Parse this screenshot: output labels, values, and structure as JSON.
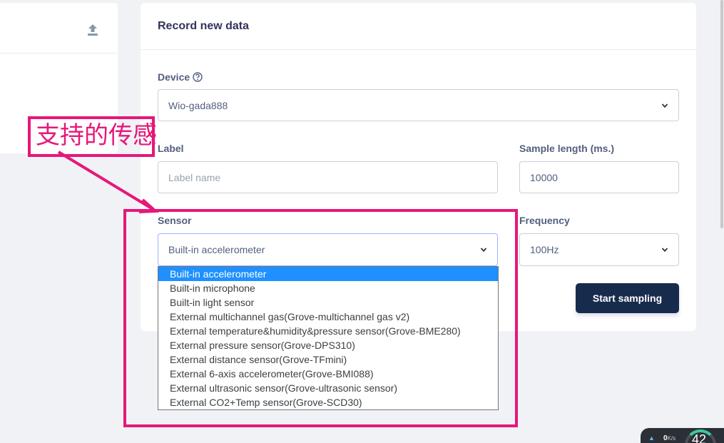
{
  "record_card": {
    "title": "Record new data",
    "device": {
      "label": "Device",
      "value": "Wio-gada888"
    },
    "label_field": {
      "label": "Label",
      "placeholder": "Label name"
    },
    "sample_length": {
      "label": "Sample length (ms.)",
      "value": "10000"
    },
    "sensor": {
      "label": "Sensor",
      "value": "Built-in accelerometer"
    },
    "frequency": {
      "label": "Frequency",
      "value": "100Hz"
    },
    "start_button": "Start sampling"
  },
  "sensor_options": [
    "Built-in accelerometer",
    "Built-in microphone",
    "Built-in light sensor",
    "External multichannel gas(Grove-multichannel gas v2)",
    "External temperature&humidity&pressure sensor(Grove-BME280)",
    "External pressure sensor(Grove-DPS310)",
    "External distance sensor(Grove-TFmini)",
    "External 6-axis accelerometer(Grove-BMI088)",
    "External ultrasonic sensor(Grove-ultrasonic sensor)",
    "External CO2+Temp sensor(Grove-SCD30)"
  ],
  "selected_option_index": 0,
  "annotation": {
    "text": "支持的传感",
    "color": "#e6177a"
  },
  "net_widget": {
    "speed": "0",
    "unit": "K/s",
    "gauge_value": "42"
  },
  "colors": {
    "primary_button": "#172b4d",
    "selection": "#1e90ff"
  }
}
